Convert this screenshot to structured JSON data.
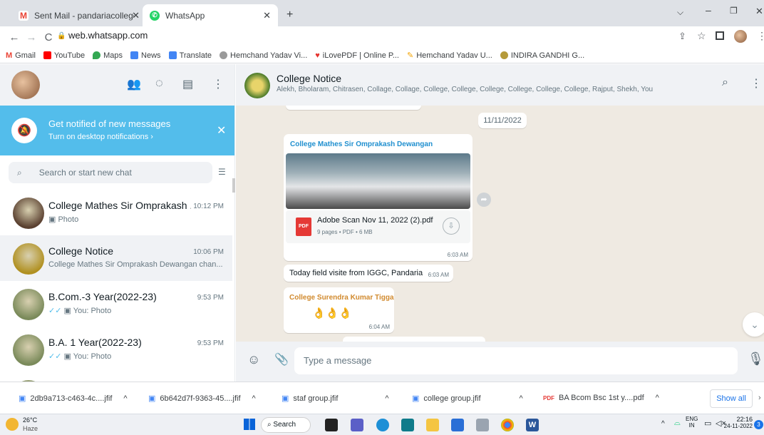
{
  "browser": {
    "tabs": [
      {
        "title": "Sent Mail - pandariacollege@gm"
      },
      {
        "title": "WhatsApp"
      }
    ],
    "url": "web.whatsapp.com",
    "bookmarks": [
      "Gmail",
      "YouTube",
      "Maps",
      "News",
      "Translate",
      "Hemchand Yadav Vi...",
      "iLovePDF | Online P...",
      "Hemchand Yadav U...",
      "INDIRA GANDHI G..."
    ]
  },
  "sidebar": {
    "notification": {
      "title": "Get notified of new messages",
      "subtitle": "Turn on desktop notifications ›"
    },
    "search_placeholder": "Search or start new chat",
    "chats": [
      {
        "name": "College Mathes Sir Omprakash ...",
        "time": "10:12 PM",
        "preview": "Photo",
        "prefix": "",
        "color": "#5a4030"
      },
      {
        "name": "College Notice",
        "time": "10:06 PM",
        "preview": "College Mathes Sir Omprakash Dewangan chan...",
        "prefix": "",
        "color": "#b09020"
      },
      {
        "name": "B.Com.-3 Year(2022-23)",
        "time": "9:53 PM",
        "preview": "You: Photo",
        "prefix": "✓✓",
        "color": "#7a8a5a"
      },
      {
        "name": "B.A. 1 Year(2022-23)",
        "time": "9:53 PM",
        "preview": "You: Photo",
        "prefix": "✓✓",
        "color": "#7a8a5a"
      },
      {
        "name": "M.A.Hindi-3sem (2020-21)",
        "time": "9:53 PM",
        "preview": "You: Photo",
        "prefix": "✓✓",
        "color": "#7a8a5a"
      }
    ]
  },
  "conversation": {
    "name": "College Notice",
    "members": "Alekh, Bholaram, Chitrasen, Collage, Collage, College, College, College, College, College, College, Rajput, Shekh, You",
    "date_chip": "11/11/2022",
    "messages": [
      {
        "sender": "College Mathes Sir Omprakash Dewangan",
        "file": "Adobe Scan Nov 11, 2022 (2).pdf",
        "file_meta": "9 pages • PDF • 6 MB",
        "file_type": "PDF",
        "time": "6:03 AM"
      },
      {
        "text": "Today field visite from IGGC, Pandaria",
        "time": "6:03 AM"
      },
      {
        "sender": "College Surendra Kumar Tigga",
        "emoji": "👌👌👌",
        "time": "6:04 AM"
      }
    ],
    "composer_placeholder": "Type a message"
  },
  "downloads": {
    "items": [
      "2db9a713-c463-4c....jfif",
      "6b642d7f-9363-45....jfif",
      "staf group.jfif",
      "college group.jfif",
      "BA Bcom Bsc 1st y....pdf"
    ],
    "show_all": "Show all"
  },
  "taskbar": {
    "weather_temp": "26°C",
    "weather_desc": "Haze",
    "search": "Search",
    "lang": "ENG",
    "region": "IN",
    "time": "22:16",
    "date": "24-11-2022",
    "badge": "3"
  }
}
